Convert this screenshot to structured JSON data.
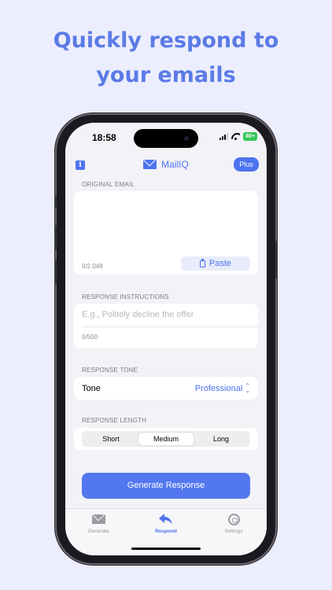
{
  "headline": {
    "line1": "Quickly respond to",
    "line2": "your emails"
  },
  "status_bar": {
    "time": "18:58",
    "battery": "80+"
  },
  "nav": {
    "info_label": "i",
    "title": "MailIQ",
    "plus_label": "Plus"
  },
  "original_email": {
    "section_label": "ORIGINAL EMAIL",
    "value": "",
    "char_count": "0/2.048",
    "paste_label": "Paste"
  },
  "instructions": {
    "section_label": "RESPONSE INSTRUCTIONS",
    "placeholder": "E.g., Politely decline the offer",
    "value": "",
    "char_count": "0/500"
  },
  "tone": {
    "section_label": "RESPONSE TONE",
    "label": "Tone",
    "value": "Professional"
  },
  "length": {
    "section_label": "RESPONSE LENGTH",
    "options": [
      "Short",
      "Medium",
      "Long"
    ],
    "selected": "Medium"
  },
  "generate_label": "Generate Response",
  "tabs": [
    {
      "label": "Generate",
      "icon": "envelope-icon"
    },
    {
      "label": "Respond",
      "icon": "reply-arrow-icon"
    },
    {
      "label": "Settings",
      "icon": "gear-icon"
    }
  ],
  "active_tab": "Respond",
  "colors": {
    "accent": "#4e73ef",
    "background": "#eceefd",
    "headline": "#5b7be6"
  }
}
